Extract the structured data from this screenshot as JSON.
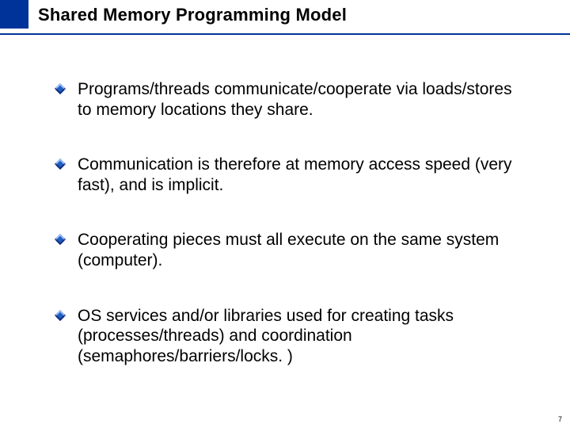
{
  "slide": {
    "title": "Shared Memory Programming Model",
    "bullets": [
      "Programs/threads communicate/cooperate via loads/stores to memory locations they share.",
      "Communication is therefore at memory access speed (very fast), and is implicit.",
      "Cooperating pieces must all execute on the same system (computer).",
      "OS services and/or libraries used for creating tasks (processes/threads) and coordination (semaphores/barriers/locks. )"
    ],
    "page_number": "7"
  }
}
